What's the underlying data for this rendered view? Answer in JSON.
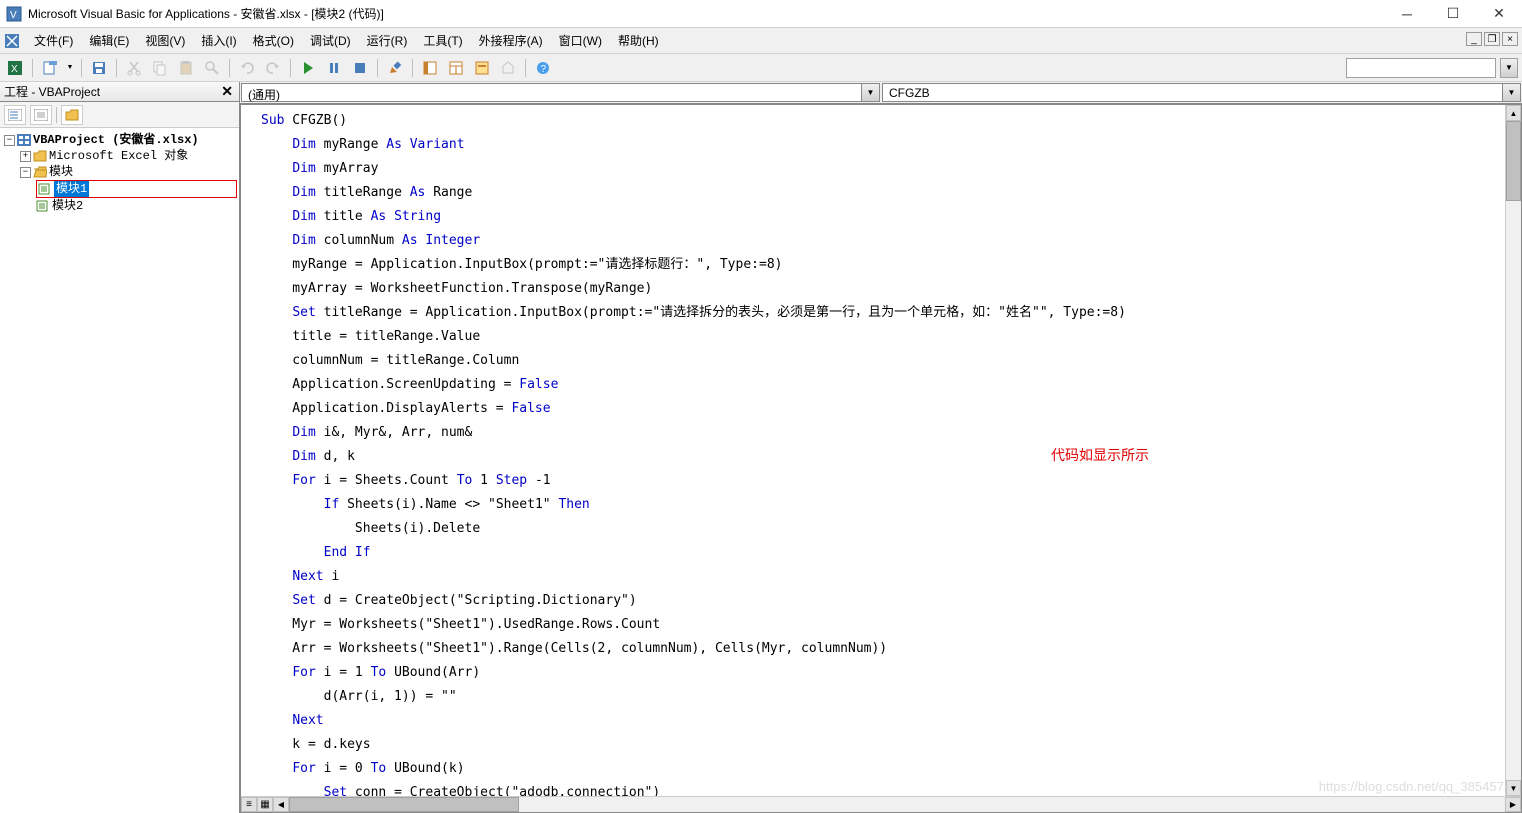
{
  "title": "Microsoft Visual Basic for Applications - 安徽省.xlsx - [模块2 (代码)]",
  "menus": [
    "文件(F)",
    "编辑(E)",
    "视图(V)",
    "插入(I)",
    "格式(O)",
    "调试(D)",
    "运行(R)",
    "工具(T)",
    "外接程序(A)",
    "窗口(W)",
    "帮助(H)"
  ],
  "project_panel": {
    "title": "工程 - VBAProject",
    "root": "VBAProject (安徽省.xlsx)",
    "excel_objects": "Microsoft Excel 对象",
    "modules_label": "模块",
    "module1": "模块1",
    "module2": "模块2"
  },
  "object_dropdown": "(通用)",
  "procedure_dropdown": "CFGZB",
  "annotation_text": "代码如显示所示",
  "watermark": "https://blog.csdn.net/qq_3854571",
  "code_tokens": [
    [
      [
        "kw",
        "Sub"
      ],
      [
        "",
        " CFGZB()"
      ]
    ],
    [],
    [
      [
        "",
        "    "
      ],
      [
        "kw",
        "Dim"
      ],
      [
        "",
        " myRange "
      ],
      [
        "kw",
        "As Variant"
      ]
    ],
    [],
    [
      [
        "",
        "    "
      ],
      [
        "kw",
        "Dim"
      ],
      [
        "",
        " myArray"
      ]
    ],
    [],
    [
      [
        "",
        "    "
      ],
      [
        "kw",
        "Dim"
      ],
      [
        "",
        " titleRange "
      ],
      [
        "kw",
        "As"
      ],
      [
        "",
        " Range"
      ]
    ],
    [],
    [
      [
        "",
        "    "
      ],
      [
        "kw",
        "Dim"
      ],
      [
        "",
        " title "
      ],
      [
        "kw",
        "As String"
      ]
    ],
    [],
    [
      [
        "",
        "    "
      ],
      [
        "kw",
        "Dim"
      ],
      [
        "",
        " columnNum "
      ],
      [
        "kw",
        "As Integer"
      ]
    ],
    [],
    [
      [
        "",
        "    myRange = Application.InputBox(prompt:=\"请选择标题行：\", Type:=8)"
      ]
    ],
    [],
    [
      [
        "",
        "    myArray = WorksheetFunction.Transpose(myRange)"
      ]
    ],
    [],
    [
      [
        "",
        "    "
      ],
      [
        "kw",
        "Set"
      ],
      [
        "",
        " titleRange = Application.InputBox(prompt:=\"请选择拆分的表头，必须是第一行，且为一个单元格，如：\"姓名\"\", Type:=8)"
      ]
    ],
    [],
    [
      [
        "",
        "    title = titleRange.Value"
      ]
    ],
    [],
    [
      [
        "",
        "    columnNum = titleRange.Column"
      ]
    ],
    [],
    [
      [
        "",
        "    Application.ScreenUpdating = "
      ],
      [
        "kw",
        "False"
      ]
    ],
    [],
    [
      [
        "",
        "    Application.DisplayAlerts = "
      ],
      [
        "kw",
        "False"
      ]
    ],
    [],
    [
      [
        "",
        "    "
      ],
      [
        "kw",
        "Dim"
      ],
      [
        "",
        " i&, Myr&, Arr, num&"
      ]
    ],
    [],
    [
      [
        "",
        "    "
      ],
      [
        "kw",
        "Dim"
      ],
      [
        "",
        " d, k"
      ]
    ],
    [],
    [
      [
        "",
        "    "
      ],
      [
        "kw",
        "For"
      ],
      [
        "",
        " i = Sheets.Count "
      ],
      [
        "kw",
        "To"
      ],
      [
        "",
        " 1 "
      ],
      [
        "kw",
        "Step"
      ],
      [
        "",
        " -1"
      ]
    ],
    [],
    [
      [
        "",
        "        "
      ],
      [
        "kw",
        "If"
      ],
      [
        "",
        " Sheets(i).Name <> \"Sheet1\" "
      ],
      [
        "kw",
        "Then"
      ]
    ],
    [
      [
        "",
        "            Sheets(i).Delete"
      ]
    ],
    [],
    [
      [
        "",
        "        "
      ],
      [
        "kw",
        "End If"
      ]
    ],
    [],
    [
      [
        "",
        "    "
      ],
      [
        "kw",
        "Next"
      ],
      [
        "",
        " i"
      ]
    ],
    [],
    [
      [
        "",
        "    "
      ],
      [
        "kw",
        "Set"
      ],
      [
        "",
        " d = CreateObject(\"Scripting.Dictionary\")"
      ]
    ],
    [],
    [
      [
        "",
        "    Myr = Worksheets(\"Sheet1\").UsedRange.Rows.Count"
      ]
    ],
    [],
    [
      [
        "",
        "    Arr = Worksheets(\"Sheet1\").Range(Cells(2, columnNum), Cells(Myr, columnNum))"
      ]
    ],
    [],
    [
      [
        "",
        "    "
      ],
      [
        "kw",
        "For"
      ],
      [
        "",
        " i = 1 "
      ],
      [
        "kw",
        "To"
      ],
      [
        "",
        " UBound(Arr)"
      ]
    ],
    [],
    [
      [
        "",
        "        d(Arr(i, 1)) = \"\""
      ]
    ],
    [],
    [
      [
        "",
        "    "
      ],
      [
        "kw",
        "Next"
      ]
    ],
    [],
    [
      [
        "",
        "    k = d.keys"
      ]
    ],
    [],
    [
      [
        "",
        "    "
      ],
      [
        "kw",
        "For"
      ],
      [
        "",
        " i = 0 "
      ],
      [
        "kw",
        "To"
      ],
      [
        "",
        " UBound(k)"
      ]
    ],
    [],
    [
      [
        "",
        "        "
      ],
      [
        "kw",
        "Set"
      ],
      [
        "",
        " conn = CreateObject(\"adodb.connection\")"
      ]
    ]
  ]
}
